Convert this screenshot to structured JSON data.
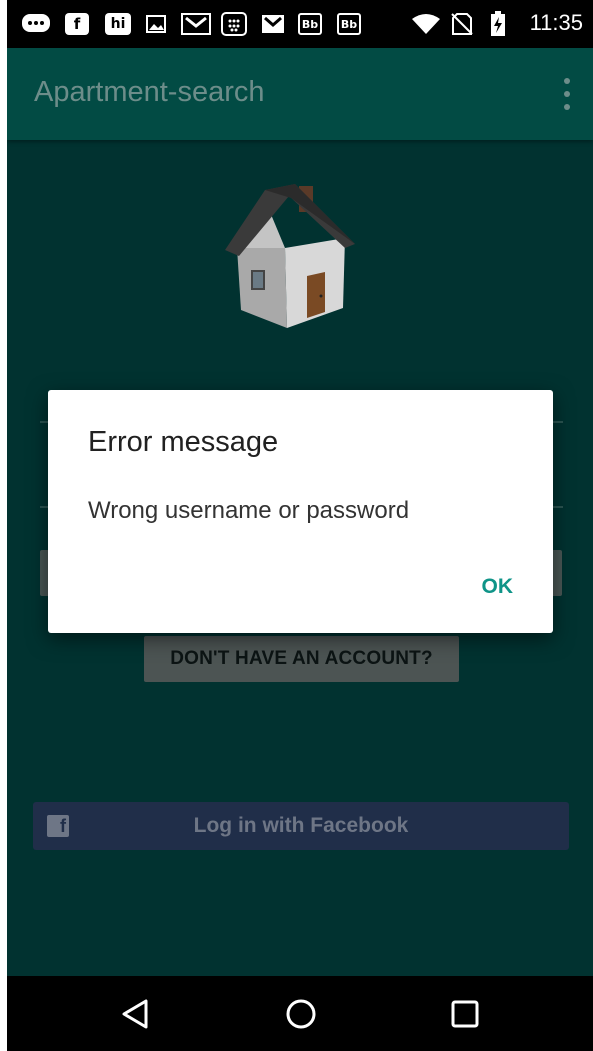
{
  "status_bar": {
    "time": "11:35",
    "icons": [
      "messaging-icon",
      "facebook-icon",
      "hi-icon",
      "image-icon",
      "gmail-icon",
      "calendar-icon",
      "gmail-icon",
      "blackboard-icon",
      "blackboard-icon",
      "wifi-icon",
      "no-sim-icon",
      "battery-charging-icon"
    ],
    "bb_label": "Bb",
    "hi_label": "hi",
    "fb_label": "f"
  },
  "toolbar": {
    "title": "Apartment-search"
  },
  "login": {
    "signup_label": "DON'T HAVE AN ACCOUNT?",
    "facebook_label": "Log in with Facebook",
    "facebook_glyph": "f"
  },
  "dialog": {
    "title": "Error message",
    "message": "Wrong username or password",
    "ok_label": "OK"
  },
  "colors": {
    "toolbar": "#024b44",
    "background": "#013230",
    "dialog_accent": "#0f9488",
    "facebook": "#202e49"
  }
}
